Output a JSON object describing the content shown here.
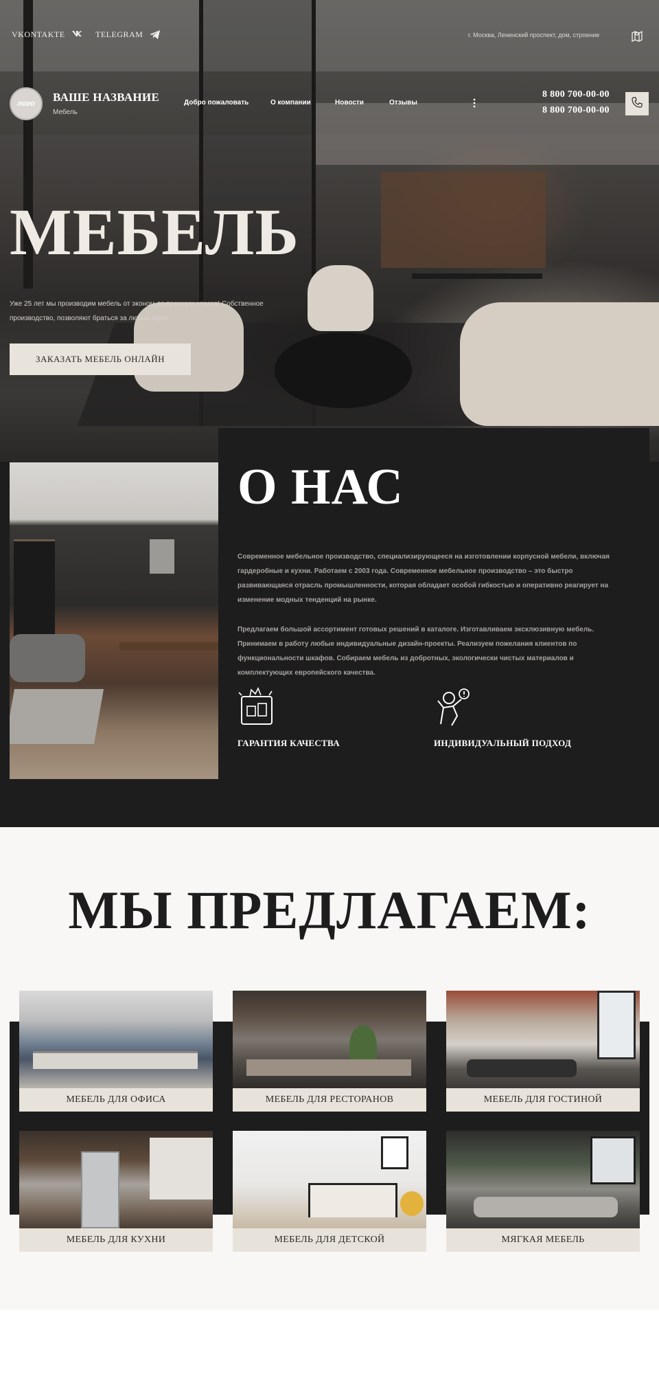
{
  "topbar": {
    "social_1": "VKONTAKTE",
    "social_2": "TELEGRAM",
    "address": "г. Москва, Ленинский проспект, дом, строение"
  },
  "header": {
    "logo_text": "лого",
    "brand_name": "ВАШЕ НАЗВАНИЕ",
    "brand_sub": "Мебель",
    "nav": [
      "Добро пожаловать",
      "О компании",
      "Новости",
      "Отзывы"
    ],
    "more_icon": "vertical-dots-icon",
    "phones": [
      "8 800 700-00-00",
      "8 800 700-00-00"
    ]
  },
  "hero": {
    "title": "МЕБЕЛЬ",
    "text": "Уже 25 лет мы производим мебель от эконом до премиум класса! Собственное производство, позволяют браться за любые идеи.",
    "cta": "ЗАКАЗАТЬ МЕБЕЛЬ ОНЛАЙН"
  },
  "about": {
    "title": "О НАС",
    "p1": "Современное мебельное производство, специализирующееся на изготовлении корпусной мебели, включая гардеробные и кухни. Работаем с 2003 года. Современное мебельное производство – это быстро развивающаяся отрасль промышленности, которая обладает особой гибкостью и оперативно реагирует на изменение модных тенденций на рынке.",
    "p2": "Предлагаем большой ассортимент готовых решений в каталоге. Изготавливаем эксклюзивную мебель. Принимаем в работу любые индивидуальные дизайн-проекты. Реализуем пожелания клиентов по функциональности шкафов. Собираем мебель из добротных, экологически чистых материалов и комплектующих европейского качества.",
    "features": [
      {
        "label": "ГАРАНТИЯ КАЧЕСТВА",
        "icon": "quality-guarantee-icon"
      },
      {
        "label": "ИНДИВИДУАЛЬНЫЙ ПОДХОД",
        "icon": "individual-approach-icon"
      }
    ]
  },
  "offer": {
    "title": "МЫ ПРЕДЛАГАЕМ:",
    "cards": [
      {
        "label": "МЕБЕЛЬ ДЛЯ ОФИСА"
      },
      {
        "label": "МЕБЕЛЬ ДЛЯ РЕСТОРАНОВ"
      },
      {
        "label": "МЕБЕЛЬ ДЛЯ ГОСТИНОЙ"
      },
      {
        "label": "МЕБЕЛЬ ДЛЯ КУХНИ"
      },
      {
        "label": "МЕБЕЛЬ ДЛЯ ДЕТСКОЙ"
      },
      {
        "label": "МЯГКАЯ МЕБЕЛЬ"
      }
    ]
  },
  "colors": {
    "dark": "#1d1d1d",
    "beige": "#e8e3da",
    "light_bg": "#f8f7f5"
  }
}
